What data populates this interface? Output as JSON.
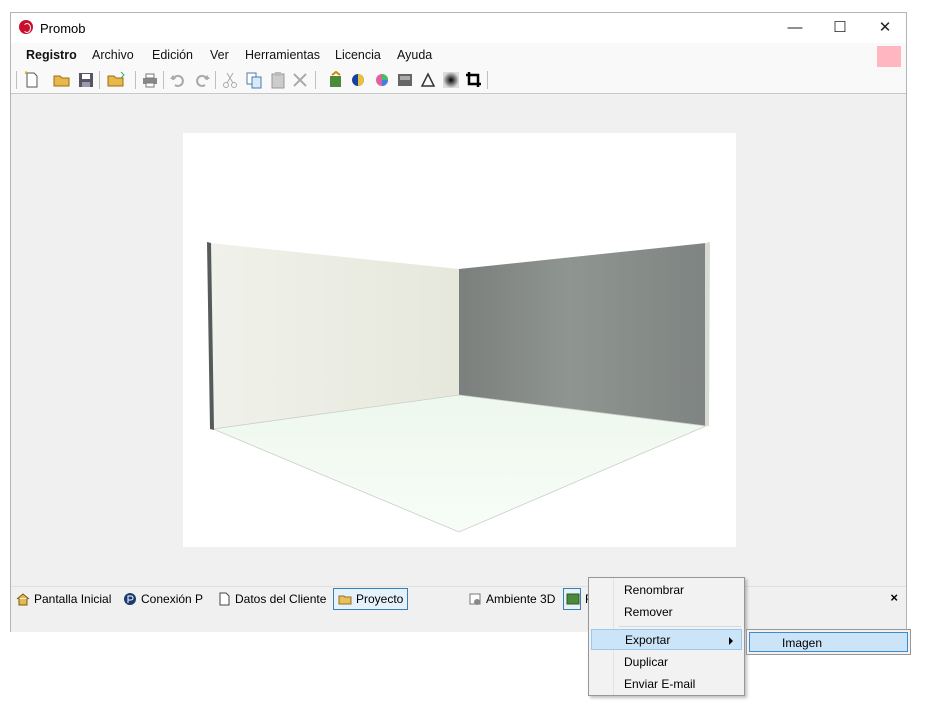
{
  "window": {
    "title": "Promob",
    "min_glyph": "—",
    "max_glyph": "☐",
    "close_glyph": "✕"
  },
  "menu": [
    "Registro",
    "Archivo",
    "Edición",
    "Ver",
    "Herramientas",
    "Licencia",
    "Ayuda"
  ],
  "toolbar_icons": [
    "new-file-icon",
    "open-folder-icon",
    "save-icon",
    "export-icon",
    "print-icon",
    "undo-icon",
    "redo-icon",
    "cut-icon",
    "copy-icon",
    "paste-icon",
    "delete-icon",
    "render-icon",
    "sphere-icon",
    "color-wheel-icon",
    "image-icon",
    "triangle-icon",
    "blur-icon",
    "crop-icon"
  ],
  "tabs": {
    "pantalla_inicial": "Pantalla Inicial",
    "conexion": "Conexión P",
    "datos_cliente": "Datos del Cliente",
    "proyecto": "Proyecto",
    "ambiente3d": "Ambiente 3D",
    "partial": "F",
    "close": "×"
  },
  "context_menu": {
    "items": [
      "Renombrar",
      "Remover",
      "Exportar",
      "Duplicar",
      "Enviar E-mail"
    ],
    "highlighted": "Exportar"
  },
  "submenu": {
    "item": "Imagen"
  },
  "colors": {
    "accent": "#cce4f7",
    "pink_box": "#ffb6c1"
  }
}
